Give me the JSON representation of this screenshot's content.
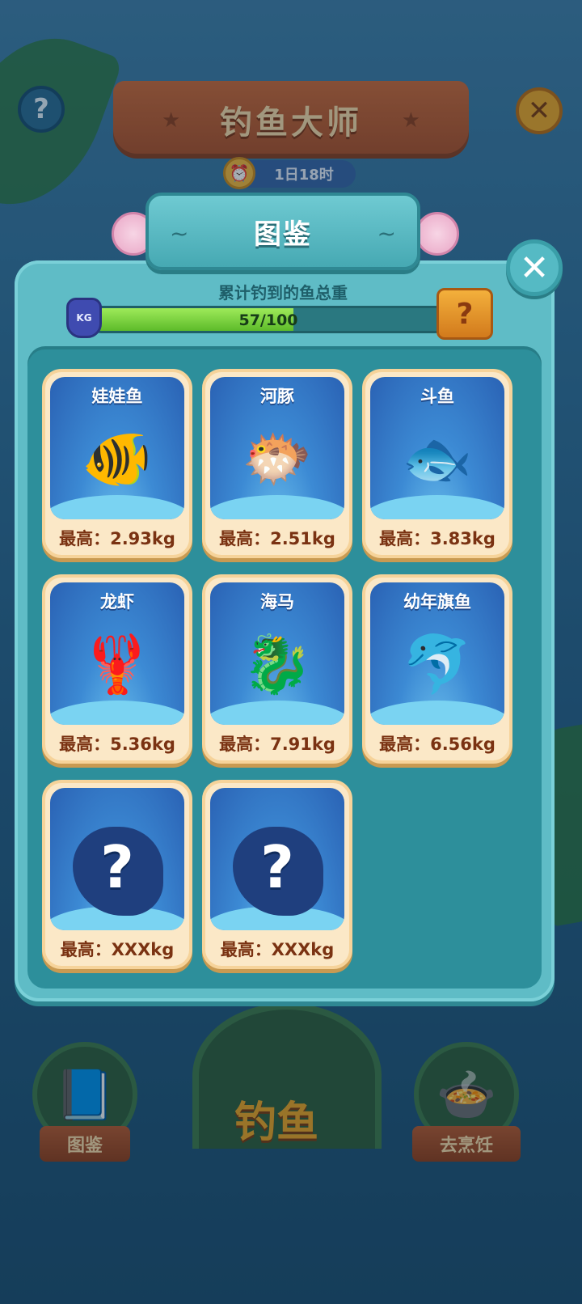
{
  "game": {
    "title": "钓鱼大师",
    "timer": "1日18时",
    "help_label": "?",
    "close_label": "✕"
  },
  "modal": {
    "title": "图鉴",
    "close_label": "✕",
    "progress_caption": "累计钓到的鱼总重",
    "progress_value": 57,
    "progress_max": 100,
    "progress_text": "57/100",
    "kg_label": "KG",
    "reward_label": "?"
  },
  "cards": [
    {
      "name": "娃娃鱼",
      "weight": "最高：2.93kg",
      "icon": "clownfish-icon",
      "glyph": "🐠",
      "unlocked": true
    },
    {
      "name": "河豚",
      "weight": "最高：2.51kg",
      "icon": "pufferfish-icon",
      "glyph": "🐡",
      "unlocked": true
    },
    {
      "name": "斗鱼",
      "weight": "最高：3.83kg",
      "icon": "betta-fish-icon",
      "glyph": "🐟",
      "unlocked": true
    },
    {
      "name": "龙虾",
      "weight": "最高：5.36kg",
      "icon": "lobster-icon",
      "glyph": "🦞",
      "unlocked": true
    },
    {
      "name": "海马",
      "weight": "最高：7.91kg",
      "icon": "seahorse-icon",
      "glyph": "🐉",
      "unlocked": true
    },
    {
      "name": "幼年旗鱼",
      "weight": "最高：6.56kg",
      "icon": "marlin-icon",
      "glyph": "🐬",
      "unlocked": true
    },
    {
      "name": "",
      "weight": "最高：XXXkg",
      "icon": "locked-anglerfish-icon",
      "glyph": "?",
      "unlocked": false
    },
    {
      "name": "",
      "weight": "最高：XXXkg",
      "icon": "locked-dolphin-icon",
      "glyph": "?",
      "unlocked": false
    }
  ],
  "bottom_nav": {
    "collection_label": "图鉴",
    "fishing_label": "钓鱼",
    "cook_label": "去烹饪"
  }
}
